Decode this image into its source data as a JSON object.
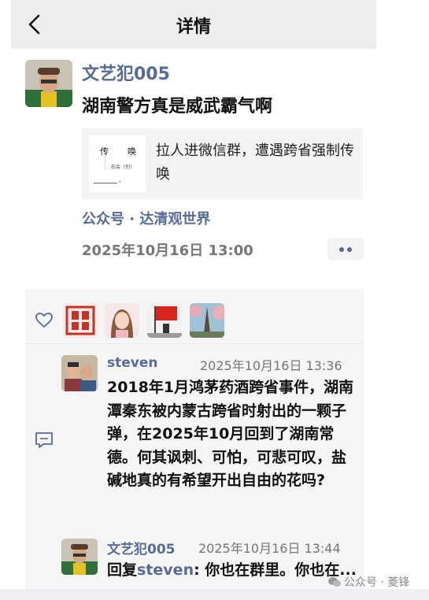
{
  "navbar": {
    "title": "详情"
  },
  "post": {
    "author": "文艺犯005",
    "text": "湖南警方真是威武霸气啊",
    "share": {
      "title": "拉人进微信群，遭遇跨省强制传唤",
      "thumb_char_1": "传",
      "thumb_char_2": "唤",
      "thumb_sub": "石会（刑）",
      "thumb_mark": "。"
    },
    "source": "公众号 · 达清观世界",
    "time": "2025年10月16日 13:00"
  },
  "comments": [
    {
      "author": "steven",
      "time": "2025年10月16日 13:36",
      "text": "2018年1月鸿茅药酒跨省事件，湖南潭秦东被内蒙古跨省时射出的一颗子弹，在2025年10月回到了湖南常德。何其讽刺、可怕，可悲可叹，盐碱地真的有希望开出自由的花吗?"
    },
    {
      "author": "文艺犯005",
      "time": "2025年10月16日 13:44",
      "reply_prefix": "回复",
      "reply_to": "steven",
      "text": ": 你也在群里。你也在..."
    }
  ],
  "watermark": "公众号 · 菱锋",
  "colors": {
    "link": "#576b95",
    "navbar_bg": "#ededed",
    "panel_bg": "#f5f5f5"
  },
  "icons": [
    "back-arrow-icon",
    "heart-icon",
    "comment-icon",
    "more-dots-icon",
    "wechat-icon"
  ]
}
